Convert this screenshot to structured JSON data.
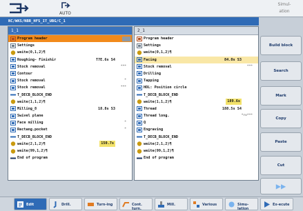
{
  "header": {
    "channel_icon_text": "AUTO",
    "mode_label": "Simul-\nation"
  },
  "path": "NC/WKS/NBR_HFS_IT_UBG/C_1",
  "left_panel": {
    "title": "1_1",
    "rows": [
      {
        "icon": "program-header-icon",
        "label": "Program header",
        "value": "",
        "extra": "",
        "state": "sel"
      },
      {
        "icon": "settings-icon",
        "label": "Settings",
        "value": "",
        "extra": "",
        "state": ""
      },
      {
        "icon": "tool-call-icon",
        "label": "weite(0,1,2)¶",
        "value": "",
        "extra": "",
        "state": ""
      },
      {
        "icon": "roughing-icon",
        "label": "Roughing- Finishir",
        "value": "T7E.6s S4",
        "extra": "",
        "state": ""
      },
      {
        "icon": "stock-removal-icon",
        "label": "  Stock removal",
        "value": "",
        "extra": "***",
        "state": ""
      },
      {
        "icon": "contour-icon",
        "label": "  Contour",
        "value": "",
        "extra": "",
        "state": ""
      },
      {
        "icon": "stock-removal-icon",
        "label": "Stock removal",
        "value": "",
        "extra": "*",
        "state": ""
      },
      {
        "icon": "stock-removal-icon",
        "label": "Stock removal",
        "value": "",
        "extra": "***",
        "state": ""
      },
      {
        "icon": "block-end-icon",
        "label": "T_DECB_BLOCK_END",
        "value": "",
        "extra": "",
        "state": ""
      },
      {
        "icon": "tool-call-icon",
        "label": "weite(1,1,2)¶",
        "value": "",
        "extra": "",
        "state": ""
      },
      {
        "icon": "milling-icon",
        "label": "Milling_8",
        "value": "18.8s S3",
        "extra": "",
        "state": ""
      },
      {
        "icon": "swivel-icon",
        "label": "Swivel plane",
        "value": "",
        "extra": "",
        "state": ""
      },
      {
        "icon": "face-milling-icon",
        "label": "Face milling",
        "value": "",
        "extra": "*",
        "state": ""
      },
      {
        "icon": "pocket-icon",
        "label": "Rectang.pocket",
        "value": "",
        "extra": "*",
        "state": ""
      },
      {
        "icon": "block-end-icon",
        "label": "T_DECB_BLOCK_END",
        "value": "",
        "extra": "",
        "state": ""
      },
      {
        "icon": "tool-call-icon",
        "label": "weite(2,1,2)¶",
        "value": "150.7s",
        "extra": "",
        "state": "box"
      },
      {
        "icon": "tool-call-icon",
        "label": "weite(99,1,2)¶",
        "value": "",
        "extra": "",
        "state": ""
      },
      {
        "icon": "end-icon",
        "label": "End of program",
        "value": "",
        "extra": "",
        "state": ""
      }
    ]
  },
  "right_panel": {
    "title": "2_1",
    "rows": [
      {
        "icon": "program-header-icon",
        "label": "Program header",
        "value": "",
        "extra": "",
        "state": ""
      },
      {
        "icon": "settings-icon",
        "label": "Settings",
        "value": "",
        "extra": "",
        "state": ""
      },
      {
        "icon": "tool-call-icon",
        "label": "weite(0,1,2)¶",
        "value": "",
        "extra": "",
        "state": ""
      },
      {
        "icon": "facing-icon",
        "label": "Facing",
        "value": "84.0s S3",
        "extra": "",
        "state": "hl"
      },
      {
        "icon": "stock-removal-icon",
        "label": "Stock removal",
        "value": "",
        "extra": "***",
        "state": ""
      },
      {
        "icon": "drilling-icon",
        "label": "Drilling",
        "value": "",
        "extra": "",
        "state": ""
      },
      {
        "icon": "tapping-icon",
        "label": "Tapping",
        "value": "",
        "extra": "",
        "state": ""
      },
      {
        "icon": "position-circle-icon",
        "label": "HOL: Position circle",
        "value": "",
        "extra": "",
        "state": ""
      },
      {
        "icon": "block-end-icon",
        "label": "T_DECB_BLOCK_END",
        "value": "",
        "extra": "",
        "state": ""
      },
      {
        "icon": "tool-call-icon",
        "label": "weite(1,1,2)¶",
        "value": "189.6s",
        "extra": "",
        "state": "box"
      },
      {
        "icon": "thread-icon",
        "label": "Thread",
        "value": "188.5s S4",
        "extra": "",
        "state": ""
      },
      {
        "icon": "thread-long-icon",
        "label": "Thread long.",
        "value": "",
        "extra": "*ro***",
        "state": ""
      },
      {
        "icon": "q-icon",
        "label": "Q",
        "value": "",
        "extra": "",
        "state": ""
      },
      {
        "icon": "engraving-icon",
        "label": "Engraving",
        "value": "",
        "extra": "",
        "state": ""
      },
      {
        "icon": "block-end-icon",
        "label": "T_DECB_BLOCK_END",
        "value": "",
        "extra": "",
        "state": ""
      },
      {
        "icon": "tool-call-icon",
        "label": "weite(2,1,2)¶",
        "value": "",
        "extra": "",
        "state": ""
      },
      {
        "icon": "tool-call-icon",
        "label": "weite(99,1,2)¶",
        "value": "",
        "extra": "",
        "state": ""
      },
      {
        "icon": "end-icon",
        "label": "End of program",
        "value": "",
        "extra": "",
        "state": ""
      }
    ]
  },
  "right_softkeys": [
    "Build block",
    "Search",
    "Mark",
    "Copy",
    "Paste",
    "Cut"
  ],
  "bottom_softkeys": [
    "Edit",
    "Drill.",
    "Turn-ing",
    "Cont. turn.",
    "Mill.",
    "Various",
    "Simu-lation",
    "Ex-ecute"
  ],
  "colors": {
    "accent": "#2f6bb6",
    "selection": "#f28a1c",
    "highlight": "#f9e7a6",
    "time_box": "#f3e26a"
  }
}
